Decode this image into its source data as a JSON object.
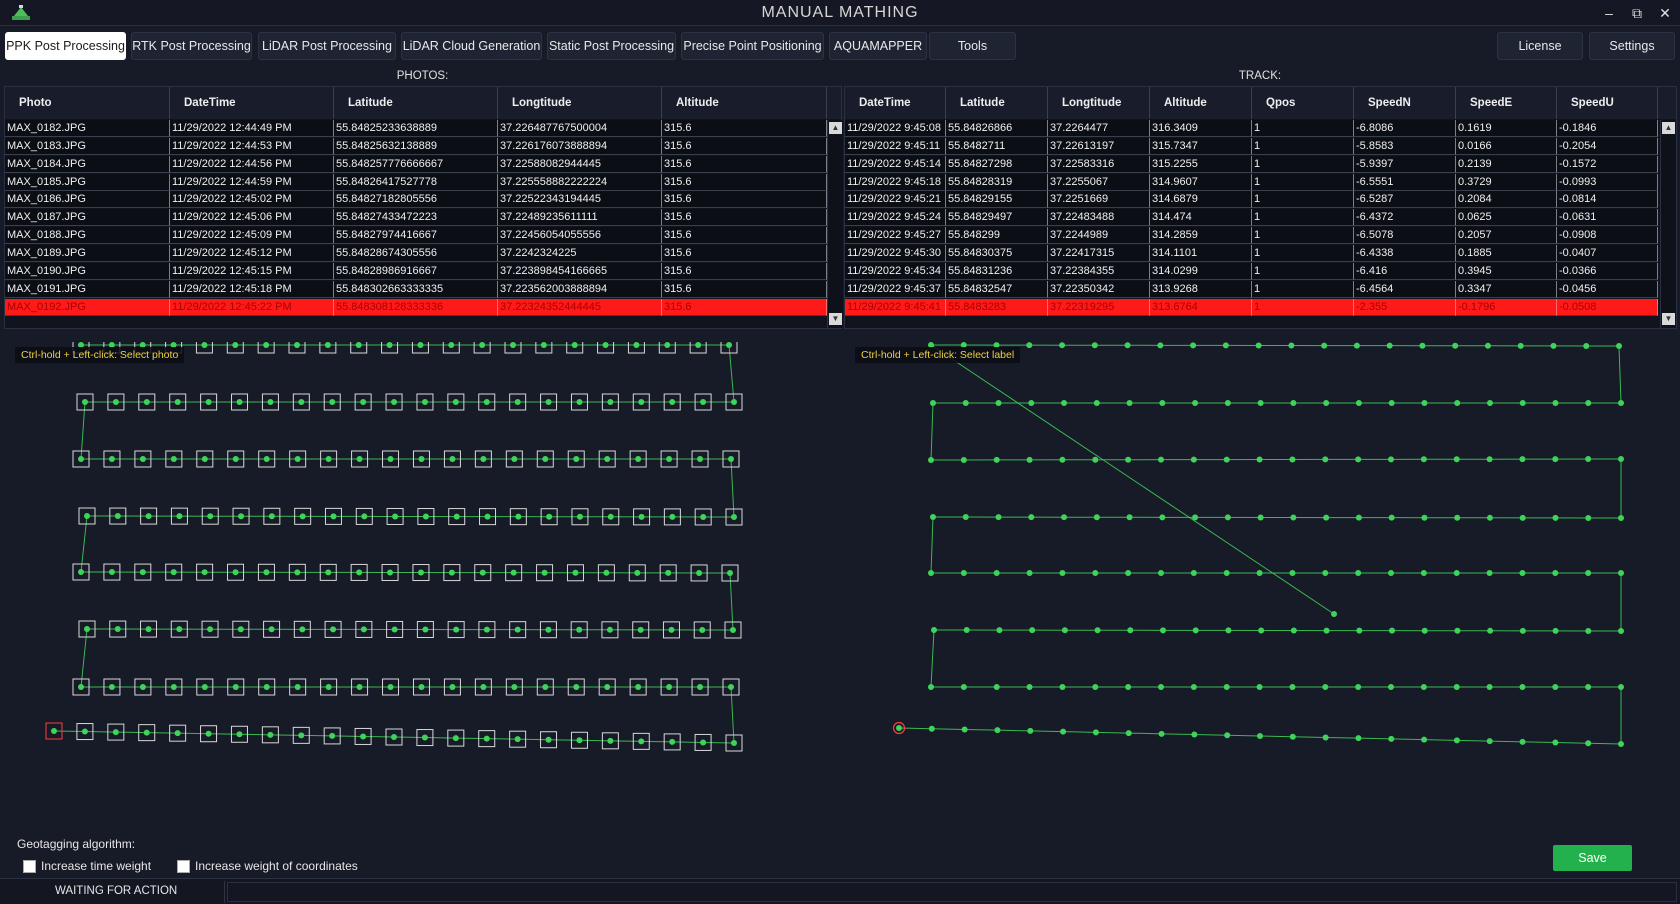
{
  "window": {
    "title": "MANUAL MATHING",
    "minimize_icon": "minimize-icon",
    "restore_icon": "restore-icon",
    "close_icon": "close-icon"
  },
  "tabs": [
    {
      "label": "PPK Post Processing",
      "active": true
    },
    {
      "label": "RTK Post Processing",
      "active": false
    },
    {
      "label": "LiDAR Post Processing",
      "active": false
    },
    {
      "label": "LiDAR Cloud Generation",
      "active": false
    },
    {
      "label": "Static Post Processing",
      "active": false
    },
    {
      "label": "Precise Point Positioning",
      "active": false
    },
    {
      "label": "AQUAMAPPER",
      "active": false
    },
    {
      "label": "Tools",
      "active": false
    }
  ],
  "right_tabs": [
    {
      "label": "License"
    },
    {
      "label": "Settings"
    }
  ],
  "photos": {
    "label": "PHOTOS:",
    "columns": [
      "Photo",
      "DateTime",
      "Latitude",
      "Longtitude",
      "Altitude"
    ],
    "rows": [
      [
        "MAX_0182.JPG",
        "11/29/2022 12:44:49 PM",
        "55.84825233638889",
        "37.226487767500004",
        "315.6"
      ],
      [
        "MAX_0183.JPG",
        "11/29/2022 12:44:53 PM",
        "55.84825632138889",
        "37.226176073888894",
        "315.6"
      ],
      [
        "MAX_0184.JPG",
        "11/29/2022 12:44:56 PM",
        "55.848257776666667",
        "37.22588082944445",
        "315.6"
      ],
      [
        "MAX_0185.JPG",
        "11/29/2022 12:44:59 PM",
        "55.84826417527778",
        "37.225558882222224",
        "315.6"
      ],
      [
        "MAX_0186.JPG",
        "11/29/2022 12:45:02 PM",
        "55.84827182805556",
        "37.22522343194445",
        "315.6"
      ],
      [
        "MAX_0187.JPG",
        "11/29/2022 12:45:06 PM",
        "55.84827433472223",
        "37.22489235611111",
        "315.6"
      ],
      [
        "MAX_0188.JPG",
        "11/29/2022 12:45:09 PM",
        "55.84827974416667",
        "37.22456054055556",
        "315.6"
      ],
      [
        "MAX_0189.JPG",
        "11/29/2022 12:45:12 PM",
        "55.84828674305556",
        "37.2242324225",
        "315.6"
      ],
      [
        "MAX_0190.JPG",
        "11/29/2022 12:45:15 PM",
        "55.84828986916667",
        "37.223898454166665",
        "315.6"
      ],
      [
        "MAX_0191.JPG",
        "11/29/2022 12:45:18 PM",
        "55.848302663333335",
        "37.223562003888894",
        "315.6"
      ],
      [
        "MAX_0192.JPG",
        "11/29/2022 12:45:22 PM",
        "55.848308128333336",
        "37.22324352444445",
        "315.6"
      ]
    ],
    "selected_index": 10
  },
  "track": {
    "label": "TRACK:",
    "columns": [
      "DateTime",
      "Latitude",
      "Longtitude",
      "Altitude",
      "Qpos",
      "SpeedN",
      "SpeedE",
      "SpeedU"
    ],
    "rows": [
      [
        "11/29/2022 9:45:08",
        "55.84826866",
        "37.2264477",
        "316.3409",
        "1",
        "-6.8086",
        "0.1619",
        "-0.1846"
      ],
      [
        "11/29/2022 9:45:11",
        "55.8482711",
        "37.22613197",
        "315.7347",
        "1",
        "-5.8583",
        "0.0166",
        "-0.2054"
      ],
      [
        "11/29/2022 9:45:14",
        "55.84827298",
        "37.22583316",
        "315.2255",
        "1",
        "-5.9397",
        "0.2139",
        "-0.1572"
      ],
      [
        "11/29/2022 9:45:18",
        "55.84828319",
        "37.2255067",
        "314.9607",
        "1",
        "-6.5551",
        "0.3729",
        "-0.0993"
      ],
      [
        "11/29/2022 9:45:21",
        "55.84829155",
        "37.2251669",
        "314.6879",
        "1",
        "-6.5287",
        "0.2084",
        "-0.0814"
      ],
      [
        "11/29/2022 9:45:24",
        "55.84829497",
        "37.22483488",
        "314.474",
        "1",
        "-6.4372",
        "0.0625",
        "-0.0631"
      ],
      [
        "11/29/2022 9:45:27",
        "55.848299",
        "37.2244989",
        "314.2859",
        "1",
        "-6.5078",
        "0.2057",
        "-0.0908"
      ],
      [
        "11/29/2022 9:45:30",
        "55.84830375",
        "37.22417315",
        "314.1101",
        "1",
        "-6.4338",
        "0.1885",
        "-0.0407"
      ],
      [
        "11/29/2022 9:45:34",
        "55.84831236",
        "37.22384355",
        "314.0299",
        "1",
        "-6.416",
        "0.3945",
        "-0.0366"
      ],
      [
        "11/29/2022 9:45:37",
        "55.84832547",
        "37.22350342",
        "313.9268",
        "1",
        "-6.4564",
        "0.3347",
        "-0.0456"
      ],
      [
        "11/29/2022 9:45:41",
        "55.8483283",
        "37.22319295",
        "313.6764",
        "1",
        "-2.355",
        "-0.1796",
        "-0.0508"
      ]
    ],
    "selected_index": 10
  },
  "photo_map": {
    "hint": "Ctrl-hold + Left-click: Select photo"
  },
  "track_map": {
    "hint": "Ctrl-hold + Left-click: Select label"
  },
  "geotagging": {
    "label": "Geotagging algorithm:",
    "options": [
      {
        "label": "Increase time weight",
        "checked": false
      },
      {
        "label": "Increase weight of coordinates",
        "checked": false
      }
    ]
  },
  "save_label": "Save",
  "status": "WAITING FOR ACTION",
  "colors": {
    "accent_green": "#22b14c",
    "selection_red": "#ff1a1a",
    "hint_yellow": "#f0d045",
    "point_green": "#3fd35a"
  }
}
